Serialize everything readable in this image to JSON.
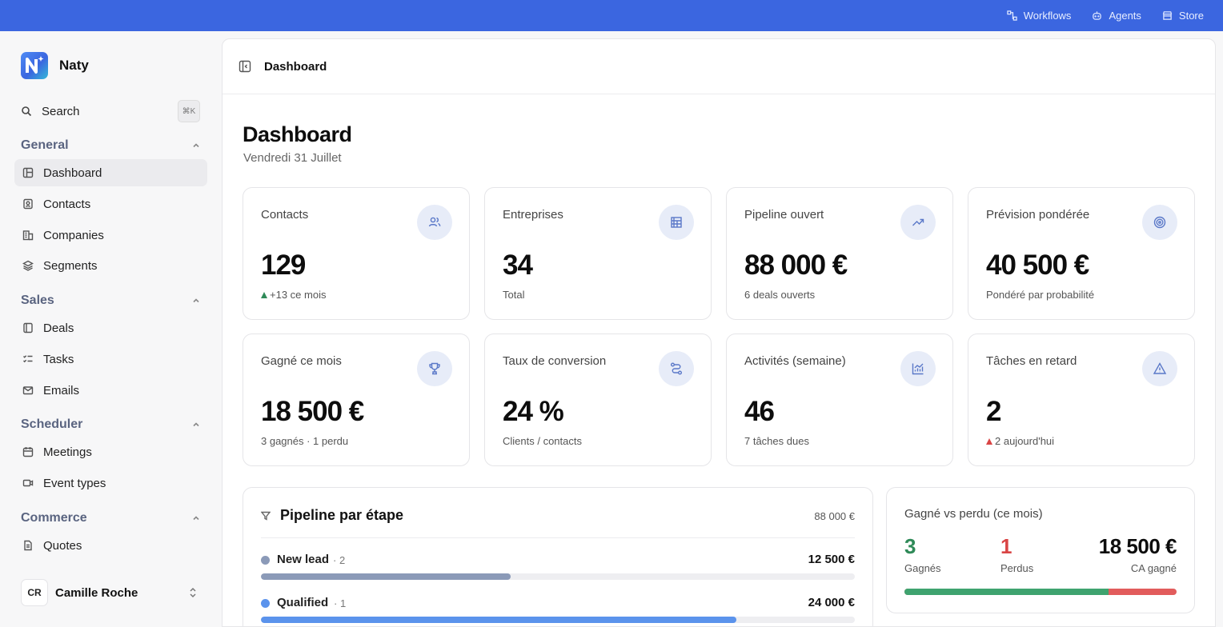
{
  "topbar": {
    "links": [
      {
        "label": "Workflows",
        "icon": "workflow-icon"
      },
      {
        "label": "Agents",
        "icon": "agent-icon"
      },
      {
        "label": "Store",
        "icon": "store-icon"
      }
    ]
  },
  "sidebar": {
    "brand": "Naty",
    "search_label": "Search",
    "search_shortcut": "⌘K",
    "sections": [
      {
        "title": "General",
        "items": [
          {
            "label": "Dashboard",
            "icon": "dashboard-icon",
            "active": true
          },
          {
            "label": "Contacts",
            "icon": "contacts-icon"
          },
          {
            "label": "Companies",
            "icon": "companies-icon"
          },
          {
            "label": "Segments",
            "icon": "segments-icon"
          }
        ]
      },
      {
        "title": "Sales",
        "items": [
          {
            "label": "Deals",
            "icon": "deals-icon"
          },
          {
            "label": "Tasks",
            "icon": "tasks-icon"
          },
          {
            "label": "Emails",
            "icon": "mail-icon"
          }
        ]
      },
      {
        "title": "Scheduler",
        "items": [
          {
            "label": "Meetings",
            "icon": "calendar-icon"
          },
          {
            "label": "Event types",
            "icon": "video-icon"
          }
        ]
      },
      {
        "title": "Commerce",
        "items": [
          {
            "label": "Quotes",
            "icon": "document-icon"
          }
        ]
      }
    ],
    "user": {
      "initials": "CR",
      "name": "Camille Roche"
    }
  },
  "main": {
    "breadcrumb": "Dashboard",
    "title": "Dashboard",
    "date": "Vendredi 31 Juillet",
    "cards": [
      {
        "label": "Contacts",
        "value": "129",
        "sub": "+13 ce mois",
        "trend": "up",
        "icon": "users-icon"
      },
      {
        "label": "Entreprises",
        "value": "34",
        "sub": "Total",
        "icon": "building-icon"
      },
      {
        "label": "Pipeline ouvert",
        "value": "88 000 €",
        "sub": "6 deals ouverts",
        "icon": "trending-up-icon"
      },
      {
        "label": "Prévision pondérée",
        "value": "40 500 €",
        "sub": "Pondéré par probabilité",
        "icon": "target-icon"
      },
      {
        "label": "Gagné ce mois",
        "value": "18 500 €",
        "sub": "3 gagnés · 1 perdu",
        "icon": "trophy-icon"
      },
      {
        "label": "Taux de conversion",
        "value": "24 %",
        "sub": "Clients / contacts",
        "icon": "route-icon"
      },
      {
        "label": "Activités (semaine)",
        "value": "46",
        "sub": "7 tâches dues",
        "icon": "activity-chart-icon"
      },
      {
        "label": "Tâches en retard",
        "value": "2",
        "sub": "2 aujourd'hui",
        "trend": "alert",
        "icon": "warning-icon"
      }
    ],
    "pipeline": {
      "title": "Pipeline par étape",
      "total": "88 000 €",
      "stages": [
        {
          "name": "New lead",
          "count": "· 2",
          "amount": "12 500 €",
          "share": 0.42,
          "color": "#8b9ab8"
        },
        {
          "name": "Qualified",
          "count": "· 1",
          "amount": "24 000 €",
          "share": 0.8,
          "color": "#5b93ec"
        }
      ]
    },
    "won_lost": {
      "title": "Gagné vs perdu (ce mois)",
      "won": "3",
      "won_label": "Gagnés",
      "lost": "1",
      "lost_label": "Perdus",
      "revenue": "18 500 €",
      "revenue_label": "CA gagné",
      "won_share": 0.75,
      "won_color": "#2f8a58",
      "lost_color": "#d94545"
    }
  }
}
